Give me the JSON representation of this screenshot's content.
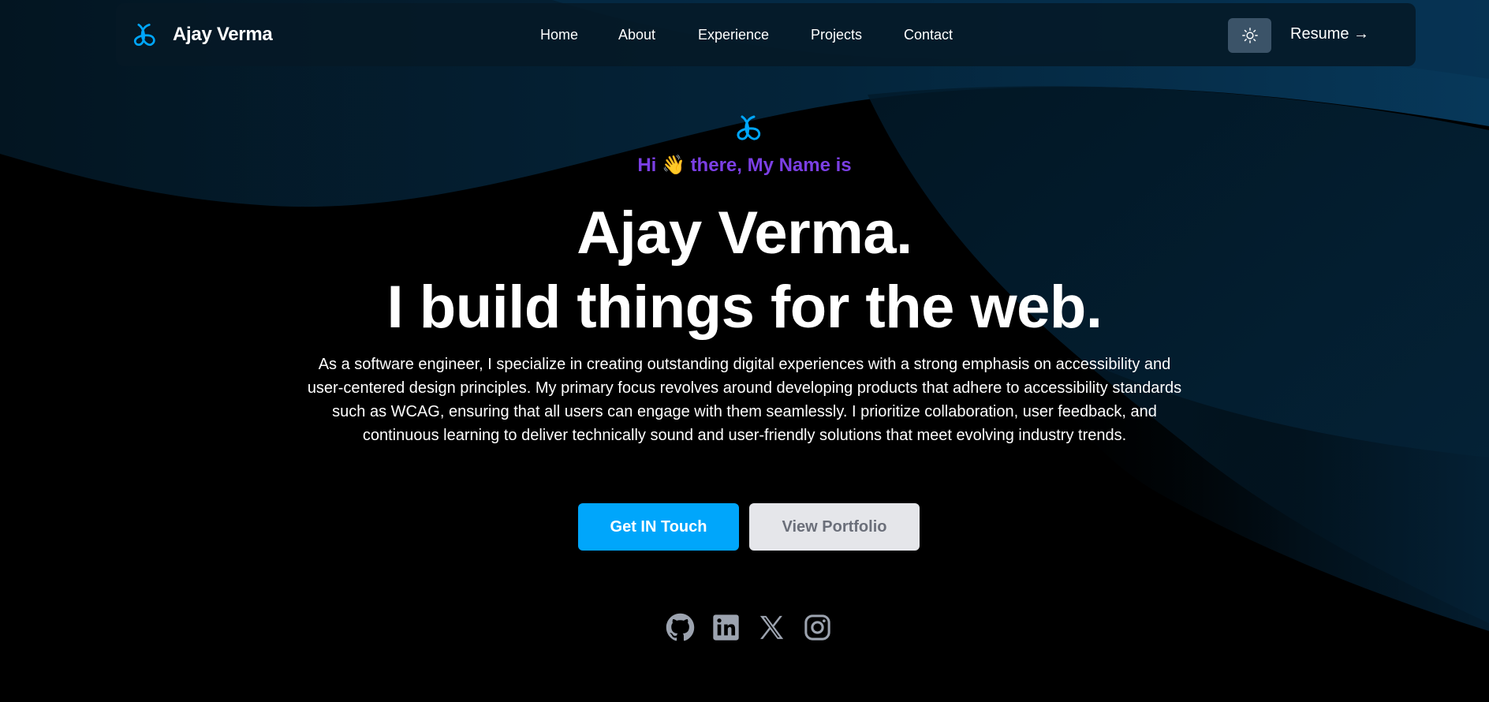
{
  "colors": {
    "accent": "#00a6fb",
    "greeting": "#7b3fe4",
    "background": "#000000",
    "navbar": "#061926",
    "theme_toggle": "#3b5368",
    "secondary_button_bg": "#e5e6ea",
    "secondary_button_text": "#6b6f7a",
    "social_icon": "#9ca3af"
  },
  "navbar": {
    "logo_icon": "atom-logo-icon",
    "brand_name": "Ajay Verma",
    "links": [
      {
        "label": "Home"
      },
      {
        "label": "About"
      },
      {
        "label": "Experience"
      },
      {
        "label": "Projects"
      },
      {
        "label": "Contact"
      }
    ],
    "theme_toggle_icon": "sun-icon",
    "resume_label": "Resume →"
  },
  "hero": {
    "logo_icon": "atom-logo-icon",
    "greeting": "Hi 👋 there, My Name is",
    "headline_line1": "Ajay Verma.",
    "headline_line2": "I build things for the web.",
    "description": "As a software engineer, I specialize in creating outstanding digital experiences with a strong emphasis on accessibility and user-centered design principles. My primary focus revolves around developing products that adhere to accessibility standards such as WCAG, ensuring that all users can engage with them seamlessly. I prioritize collaboration, user feedback, and continuous learning to deliver technically sound and user-friendly solutions that meet evolving industry trends.",
    "primary_button": "Get IN Touch",
    "secondary_button": "View Portfolio"
  },
  "socials": [
    {
      "icon": "github-icon"
    },
    {
      "icon": "linkedin-icon"
    },
    {
      "icon": "x-twitter-icon"
    },
    {
      "icon": "instagram-icon"
    }
  ]
}
